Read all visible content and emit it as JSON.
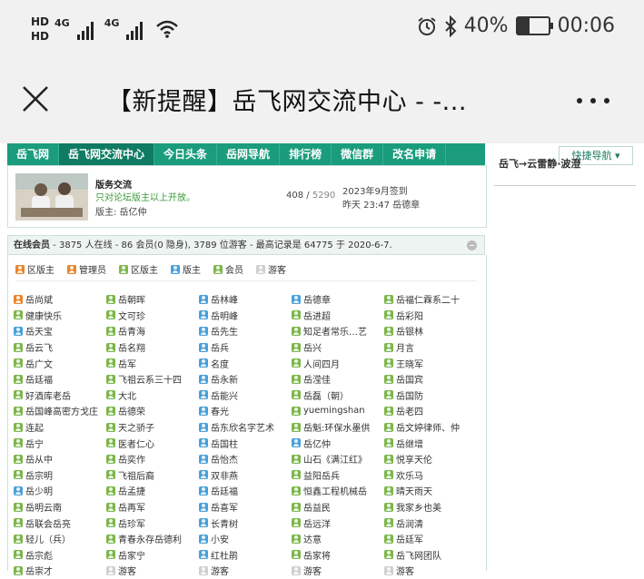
{
  "status_bar": {
    "hd1": "HD",
    "hd2": "HD",
    "net1": "4G",
    "net2": "4G",
    "battery": "40%",
    "battery_level": 0.4,
    "time": "00:06",
    "icons": [
      "alarm-icon",
      "bluetooth-icon",
      "battery-icon",
      "wifi-icon"
    ]
  },
  "title_bar": {
    "title": "【新提醒】岳飞网交流中心 - -..."
  },
  "nav": {
    "items": [
      "岳飞网",
      "岳飞网交流中心",
      "今日头条",
      "岳网导航",
      "排行榜",
      "微信群",
      "改名申请"
    ],
    "active": 1,
    "quick_nav": "快捷导航 ▾",
    "colors": {
      "bar": "#1a9c7d",
      "active": "#0f7b63"
    }
  },
  "side": {
    "title": "岳飞→云雷静·波澄"
  },
  "forum": {
    "name": "版务交流",
    "desc": "只对论坛版主以上开放。",
    "mod": "版主: 岳亿仲",
    "threads": "408",
    "posts": "5290",
    "last_title": "2023年9月签到",
    "last_info": "昨天 23:47 岳德章"
  },
  "online": {
    "header_strong": "在线会员",
    "header_text": " - 3875 人在线 - 86 会员(0 隐身), 3789 位游客 - 最高记录是 64775 于 2020-6-7.",
    "legend": [
      {
        "label": "区版主",
        "color": "orange"
      },
      {
        "label": "管理员",
        "color": "orange"
      },
      {
        "label": "区版主",
        "color": "green"
      },
      {
        "label": "版主",
        "color": "blue"
      },
      {
        "label": "会员",
        "color": "green"
      },
      {
        "label": "游客",
        "color": "gray"
      }
    ],
    "users": [
      {
        "n": "岳尚斌",
        "c": "orange"
      },
      {
        "n": "岳朝晖",
        "c": "green"
      },
      {
        "n": "岳林峰",
        "c": "blue"
      },
      {
        "n": "岳德章",
        "c": "blue"
      },
      {
        "n": "岳福仁霖系二十",
        "c": "green"
      },
      {
        "n": "健康快乐",
        "c": "green"
      },
      {
        "n": "文可珍",
        "c": "green"
      },
      {
        "n": "岳明峰",
        "c": "blue"
      },
      {
        "n": "岳进超",
        "c": "green"
      },
      {
        "n": "岳彩阳",
        "c": "green"
      },
      {
        "n": "岳天宝",
        "c": "blue"
      },
      {
        "n": "岳青海",
        "c": "green"
      },
      {
        "n": "岳先生",
        "c": "blue"
      },
      {
        "n": "知足者常乐…艺",
        "c": "green"
      },
      {
        "n": "岳银林",
        "c": "green"
      },
      {
        "n": "岳云飞",
        "c": "green"
      },
      {
        "n": "岳名翔",
        "c": "green"
      },
      {
        "n": "岳兵",
        "c": "blue"
      },
      {
        "n": "岳兴",
        "c": "green"
      },
      {
        "n": "月言",
        "c": "green"
      },
      {
        "n": "岳广文",
        "c": "green"
      },
      {
        "n": "岳军",
        "c": "green"
      },
      {
        "n": "名度",
        "c": "blue"
      },
      {
        "n": "人间四月",
        "c": "green"
      },
      {
        "n": "王晓军",
        "c": "green"
      },
      {
        "n": "岳廷福",
        "c": "green"
      },
      {
        "n": "飞祖云系三十四",
        "c": "green"
      },
      {
        "n": "岳永新",
        "c": "blue"
      },
      {
        "n": "岳滢佳",
        "c": "green"
      },
      {
        "n": "岳国宾",
        "c": "green"
      },
      {
        "n": "好酒库老岳",
        "c": "green"
      },
      {
        "n": "大北",
        "c": "green"
      },
      {
        "n": "岳能兴",
        "c": "blue"
      },
      {
        "n": "岳磊（朝）",
        "c": "green"
      },
      {
        "n": "岳国防",
        "c": "green"
      },
      {
        "n": "岳国峰高密方戈庄",
        "c": "green"
      },
      {
        "n": "岳德荣",
        "c": "green"
      },
      {
        "n": "春光",
        "c": "blue"
      },
      {
        "n": "yuemingshan",
        "c": "green"
      },
      {
        "n": "岳老四",
        "c": "green"
      },
      {
        "n": "连起",
        "c": "green"
      },
      {
        "n": "天之骄子",
        "c": "green"
      },
      {
        "n": "岳东欣名字艺术",
        "c": "blue"
      },
      {
        "n": "岳魁:环保水墨供",
        "c": "green"
      },
      {
        "n": "岳文婷律师、仲",
        "c": "green"
      },
      {
        "n": "岳宁",
        "c": "green"
      },
      {
        "n": "医者仁心",
        "c": "green"
      },
      {
        "n": "岳国柱",
        "c": "blue"
      },
      {
        "n": "岳亿仲",
        "c": "blue"
      },
      {
        "n": "岳继增",
        "c": "green"
      },
      {
        "n": "岳从中",
        "c": "green"
      },
      {
        "n": "岳奕作",
        "c": "green"
      },
      {
        "n": "岳怡杰",
        "c": "blue"
      },
      {
        "n": "山石《满江红》",
        "c": "green"
      },
      {
        "n": "悦享天伦",
        "c": "green"
      },
      {
        "n": "岳宗明",
        "c": "green"
      },
      {
        "n": "飞祖后裔",
        "c": "green"
      },
      {
        "n": "双非燕",
        "c": "blue"
      },
      {
        "n": "益阳岳兵",
        "c": "green"
      },
      {
        "n": "欢乐马",
        "c": "green"
      },
      {
        "n": "岳少明",
        "c": "blue"
      },
      {
        "n": "岳孟捷",
        "c": "green"
      },
      {
        "n": "岳廷福",
        "c": "blue"
      },
      {
        "n": "恒鑫工程机械岳",
        "c": "green"
      },
      {
        "n": "晴天雨天",
        "c": "green"
      },
      {
        "n": "岳明云南",
        "c": "green"
      },
      {
        "n": "岳再军",
        "c": "green"
      },
      {
        "n": "岳喜军",
        "c": "blue"
      },
      {
        "n": "岳益民",
        "c": "green"
      },
      {
        "n": "我家乡也美",
        "c": "green"
      },
      {
        "n": "岳联会岳亮",
        "c": "green"
      },
      {
        "n": "岳珍军",
        "c": "green"
      },
      {
        "n": "长青树",
        "c": "blue"
      },
      {
        "n": "岳远洋",
        "c": "green"
      },
      {
        "n": "岳润清",
        "c": "green"
      },
      {
        "n": "轻儿（兵）",
        "c": "green"
      },
      {
        "n": "青春永存岳德利",
        "c": "green"
      },
      {
        "n": "小安",
        "c": "blue"
      },
      {
        "n": "达意",
        "c": "green"
      },
      {
        "n": "岳廷军",
        "c": "green"
      },
      {
        "n": "岳宗彪",
        "c": "green"
      },
      {
        "n": "岳家宁",
        "c": "green"
      },
      {
        "n": "红杜鹃",
        "c": "blue"
      },
      {
        "n": "岳家将",
        "c": "green"
      },
      {
        "n": "岳飞网团队",
        "c": "green"
      },
      {
        "n": "岳崇才",
        "c": "green"
      },
      {
        "n": "游客",
        "c": "gray"
      },
      {
        "n": "游客",
        "c": "gray"
      },
      {
        "n": "游客",
        "c": "gray"
      },
      {
        "n": "游客",
        "c": "gray"
      }
    ]
  }
}
